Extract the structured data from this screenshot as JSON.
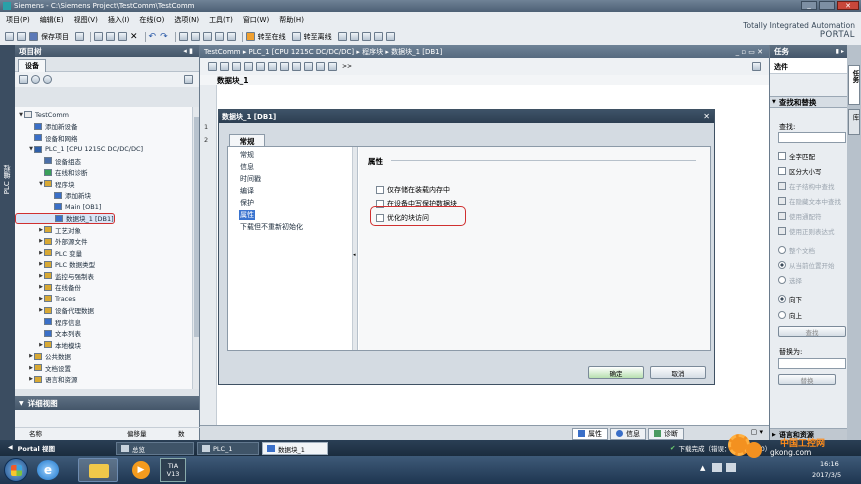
{
  "window": {
    "title": "Siemens - C:\\Siemens Project\\TestComm\\TestComm"
  },
  "menu": [
    "项目(P)",
    "编辑(E)",
    "视图(V)",
    "插入(I)",
    "在线(O)",
    "选项(N)",
    "工具(T)",
    "窗口(W)",
    "帮助(H)"
  ],
  "toolbar": {
    "save_label": "保存项目",
    "online_label": "转至在线",
    "offline_label": "转至离线"
  },
  "branding": {
    "line1": "Totally Integrated Automation",
    "line2": "PORTAL"
  },
  "side_tab_left": "PLC 编程",
  "project_tree": {
    "title": "项目树",
    "tab": "设备",
    "items": [
      {
        "label": "TestComm",
        "level": 0,
        "arrow": "▼",
        "color": "#eaeaea"
      },
      {
        "label": "添加新设备",
        "level": 1,
        "arrow": "",
        "color": "#3a6fc8"
      },
      {
        "label": "设备和网络",
        "level": 1,
        "arrow": "",
        "color": "#3a6fc8"
      },
      {
        "label": "PLC_1 [CPU 1215C DC/DC/DC]",
        "level": 1,
        "arrow": "▼",
        "color": "#2f5fa8"
      },
      {
        "label": "设备组态",
        "level": 2,
        "arrow": "",
        "color": "#4b6fa8"
      },
      {
        "label": "在线和诊断",
        "level": 2,
        "arrow": "",
        "color": "#3aa05a"
      },
      {
        "label": "程序块",
        "level": 2,
        "arrow": "▼",
        "color": "#d8a935"
      },
      {
        "label": "添加新块",
        "level": 3,
        "arrow": "",
        "color": "#3a6fc8"
      },
      {
        "label": "Main [OB1]",
        "level": 3,
        "arrow": "",
        "color": "#3a6fc8"
      },
      {
        "label": "数据块_1 [DB1]",
        "level": 3,
        "arrow": "",
        "color": "#3a6fc8",
        "selected": true
      },
      {
        "label": "工艺对象",
        "level": 2,
        "arrow": "▶",
        "color": "#d8a935"
      },
      {
        "label": "外部源文件",
        "level": 2,
        "arrow": "▶",
        "color": "#d8a935"
      },
      {
        "label": "PLC 变量",
        "level": 2,
        "arrow": "▶",
        "color": "#d8a935"
      },
      {
        "label": "PLC 数据类型",
        "level": 2,
        "arrow": "▶",
        "color": "#d8a935"
      },
      {
        "label": "监控与强制表",
        "level": 2,
        "arrow": "▶",
        "color": "#d8a935"
      },
      {
        "label": "在线备份",
        "level": 2,
        "arrow": "▶",
        "color": "#d8a935"
      },
      {
        "label": "Traces",
        "level": 2,
        "arrow": "▶",
        "color": "#d8a935"
      },
      {
        "label": "设备代理数据",
        "level": 2,
        "arrow": "▶",
        "color": "#d8a935"
      },
      {
        "label": "程序信息",
        "level": 2,
        "arrow": "",
        "color": "#3a6fc8"
      },
      {
        "label": "文本列表",
        "level": 2,
        "arrow": "",
        "color": "#3a6fc8"
      },
      {
        "label": "本地模块",
        "level": 2,
        "arrow": "▶",
        "color": "#d8a935"
      },
      {
        "label": "公共数据",
        "level": 1,
        "arrow": "▶",
        "color": "#d8a935"
      },
      {
        "label": "文档设置",
        "level": 1,
        "arrow": "▶",
        "color": "#d8a935"
      },
      {
        "label": "语言和资源",
        "level": 1,
        "arrow": "▶",
        "color": "#d8a935"
      }
    ]
  },
  "details_view": {
    "title": "详细视图",
    "col_name": "名称",
    "col_offset": "偏移量",
    "col_count": "数"
  },
  "portal_view_label": "Portal 视图",
  "editor": {
    "breadcrumb": "TestComm ▸ PLC_1 [CPU 1215C DC/DC/DC] ▸ 程序块 ▸ 数据块_1 [DB1]",
    "block_title": "数据块_1",
    "rows": [
      "1",
      "2"
    ]
  },
  "dialog": {
    "title": "数据块_1 [DB1]",
    "tab": "常规",
    "nav": [
      {
        "label": "常规",
        "active": false
      },
      {
        "label": "信息",
        "active": false
      },
      {
        "label": "时间戳",
        "active": false
      },
      {
        "label": "编译",
        "active": false
      },
      {
        "label": "保护",
        "active": false
      },
      {
        "label": "属性",
        "active": true
      },
      {
        "label": "下载但不重新初始化",
        "active": false
      }
    ],
    "section_title": "属性",
    "options": [
      {
        "label": "仅存储在装载内存中",
        "checked": false
      },
      {
        "label": "在设备中写保护数据块",
        "checked": false
      },
      {
        "label": "优化的块访问",
        "checked": false,
        "highlighted": true
      }
    ],
    "ok_label": "确定",
    "cancel_label": "取消"
  },
  "right_panel": {
    "title": "任务",
    "options_label": "选件",
    "section": "查找和替换",
    "find_label": "查找:",
    "checkboxes": [
      {
        "label": "全字匹配",
        "enabled": true
      },
      {
        "label": "区分大小写",
        "enabled": true
      },
      {
        "label": "在子结构中查找",
        "enabled": false
      },
      {
        "label": "在隐藏文本中查找",
        "enabled": false
      },
      {
        "label": "使用通配符",
        "enabled": false
      },
      {
        "label": "使用正则表达式",
        "enabled": false
      }
    ],
    "scope_radios": [
      {
        "label": "整个文档",
        "checked": false
      },
      {
        "label": "从当前位置开始",
        "checked": true
      },
      {
        "label": "选择",
        "checked": false
      }
    ],
    "direction_radios": [
      {
        "label": "向下",
        "checked": true
      },
      {
        "label": "向上",
        "checked": false
      }
    ],
    "find_button": "查找",
    "replace_label": "替换为:",
    "replace_button": "替换",
    "bottom_section": "语言和资源",
    "side_tabs": [
      "任务",
      "库"
    ]
  },
  "inspector_tabs": [
    "属性",
    "信息",
    "诊断"
  ],
  "statusbar_msg": "下载完成（错误：0；警告：0）",
  "tasks": [
    "总览",
    "PLC_1",
    "数据块_1"
  ],
  "taskbar": {
    "tia": "TIA\nV13",
    "time": "16:16",
    "date": "2017/3/5"
  },
  "watermark": {
    "text1": "中国工控网",
    "text2": "gkong.com"
  }
}
